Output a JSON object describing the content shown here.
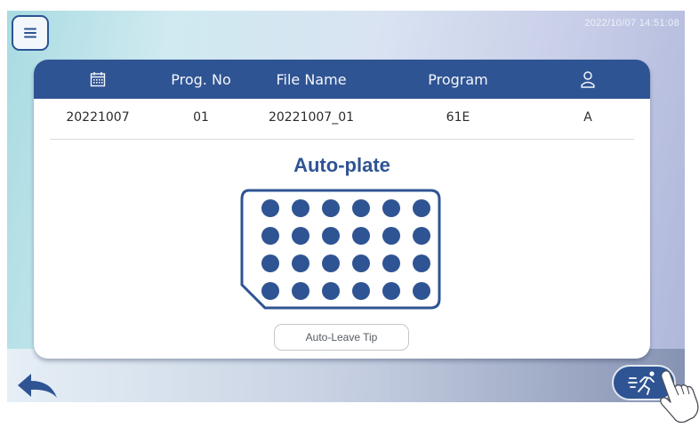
{
  "status": {
    "datetime": "2022/10/07 14:51:08"
  },
  "table": {
    "headers": [
      {
        "icon": "calendar-icon",
        "label": ""
      },
      {
        "label": "Prog. No"
      },
      {
        "label": "File Name"
      },
      {
        "label": "Program"
      },
      {
        "icon": "user-icon",
        "label": ""
      }
    ],
    "row": {
      "date": "20221007",
      "prog_no": "01",
      "file_name": "20221007_01",
      "program": "61E",
      "user": "A"
    }
  },
  "plate": {
    "title": "Auto-plate",
    "rows": 4,
    "cols": 6
  },
  "buttons": {
    "auto_leave_tip": "Auto-Leave Tip"
  },
  "icons": {
    "menu": "hamburger-menu-icon",
    "back": "back-arrow-icon",
    "run": "running-person-icon",
    "pointer": "hand-pointer-icon"
  },
  "colors": {
    "primary": "#2f5493",
    "row_text": "#2b2b2b"
  }
}
